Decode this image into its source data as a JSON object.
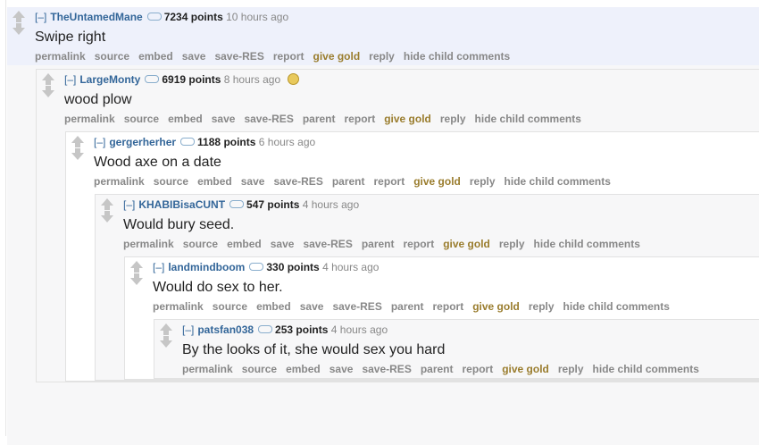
{
  "common": {
    "expand": "[–]",
    "points_suffix": "points"
  },
  "comments": [
    {
      "author": "TheUntamedMane",
      "score": "7234",
      "time": "10 hours ago",
      "body": "Swipe right",
      "buttons": [
        "permalink",
        "source",
        "embed",
        "save",
        "save-RES",
        "report",
        "give gold",
        "reply",
        "hide child comments"
      ]
    },
    {
      "author": "LargeMonty",
      "score": "6919",
      "time": "8 hours ago",
      "gilded": true,
      "body": "wood plow",
      "buttons": [
        "permalink",
        "source",
        "embed",
        "save",
        "save-RES",
        "parent",
        "report",
        "give gold",
        "reply",
        "hide child comments"
      ]
    },
    {
      "author": "gergerherher",
      "score": "1188",
      "time": "6 hours ago",
      "body": "Wood axe on a date",
      "buttons": [
        "permalink",
        "source",
        "embed",
        "save",
        "save-RES",
        "parent",
        "report",
        "give gold",
        "reply",
        "hide child comments"
      ]
    },
    {
      "author": "KHABIBisaCUNT",
      "score": "547",
      "time": "4 hours ago",
      "body": "Would bury seed.",
      "buttons": [
        "permalink",
        "source",
        "embed",
        "save",
        "save-RES",
        "parent",
        "report",
        "give gold",
        "reply",
        "hide child comments"
      ]
    },
    {
      "author": "landmindboom",
      "score": "330",
      "time": "4 hours ago",
      "body": "Would do sex to her.",
      "buttons": [
        "permalink",
        "source",
        "embed",
        "save",
        "save-RES",
        "parent",
        "report",
        "give gold",
        "reply",
        "hide child comments"
      ]
    },
    {
      "author": "patsfan038",
      "score": "253",
      "time": "4 hours ago",
      "body": "By the looks of it, she would sex you hard",
      "buttons": [
        "permalink",
        "source",
        "embed",
        "save",
        "save-RES",
        "parent",
        "report",
        "give gold",
        "reply",
        "hide child comments"
      ]
    }
  ],
  "colors": {
    "author": "#336699",
    "gold": "#9a7d2e",
    "highlight": "#eef1fb"
  }
}
